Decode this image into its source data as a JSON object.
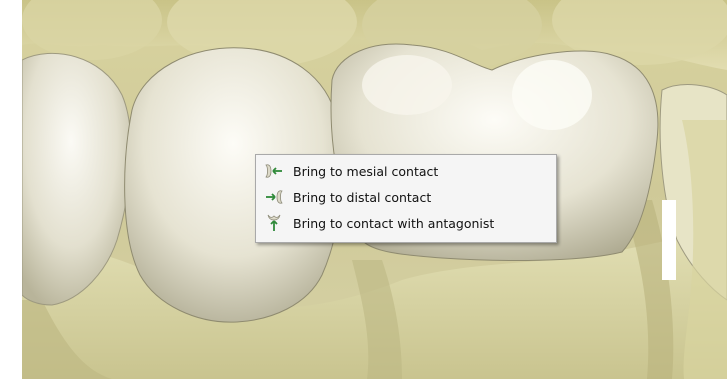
{
  "scene": {
    "description_icon": "dental-crown-3d-viewport"
  },
  "context_menu": {
    "items": [
      {
        "label": "Bring to mesial contact",
        "icon": "mesial-contact-icon"
      },
      {
        "label": "Bring to distal contact",
        "icon": "distal-contact-icon"
      },
      {
        "label": "Bring to contact with antagonist",
        "icon": "antagonist-contact-icon"
      }
    ]
  },
  "colors": {
    "menu_background": "#f5f5f5",
    "menu_border": "#a9a9a9",
    "icon_green": "#2f8a3a",
    "tooth_ivory": "#e9e6d6",
    "gum_yellow": "#d7d3a2"
  }
}
